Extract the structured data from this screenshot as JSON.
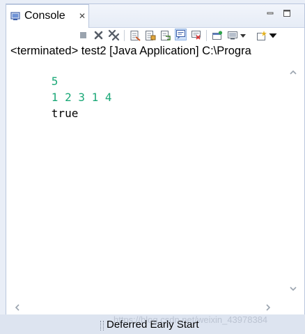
{
  "tab": {
    "title": "Console",
    "close_glyph": "✕",
    "icon": "console-icon"
  },
  "window_controls": [
    "minimize-icon",
    "maximize-icon"
  ],
  "toolbar": {
    "buttons": [
      "terminate-icon",
      "remove-launch-icon",
      "remove-all-terminated-icon",
      "clear-console-icon",
      "scroll-lock-icon",
      "word-wrap-icon",
      "show-console-on-output-icon",
      "show-console-on-error-icon",
      "pin-console-icon",
      "display-selected-console-icon",
      "display-console-dropdown-icon",
      "open-console-icon",
      "open-console-dropdown-icon"
    ],
    "active": "show-console-on-output-icon"
  },
  "header": {
    "status": "<terminated> test2 [Java Application] C:\\Progra"
  },
  "console": {
    "lines": [
      {
        "text": "5",
        "color": "#1aa877"
      },
      {
        "text": "1 2 3 1 4",
        "color": "#1aa877"
      },
      {
        "text": "true",
        "color": "#000000"
      }
    ]
  },
  "statusbar": {
    "text": "Deferred Early Start",
    "watermark": "https://blog.csdn.net/weixin_43978384"
  },
  "colors": {
    "output_green": "#1aa877",
    "tab_border": "#b9c6dd",
    "statusbar_bg": "#dde4f0"
  }
}
